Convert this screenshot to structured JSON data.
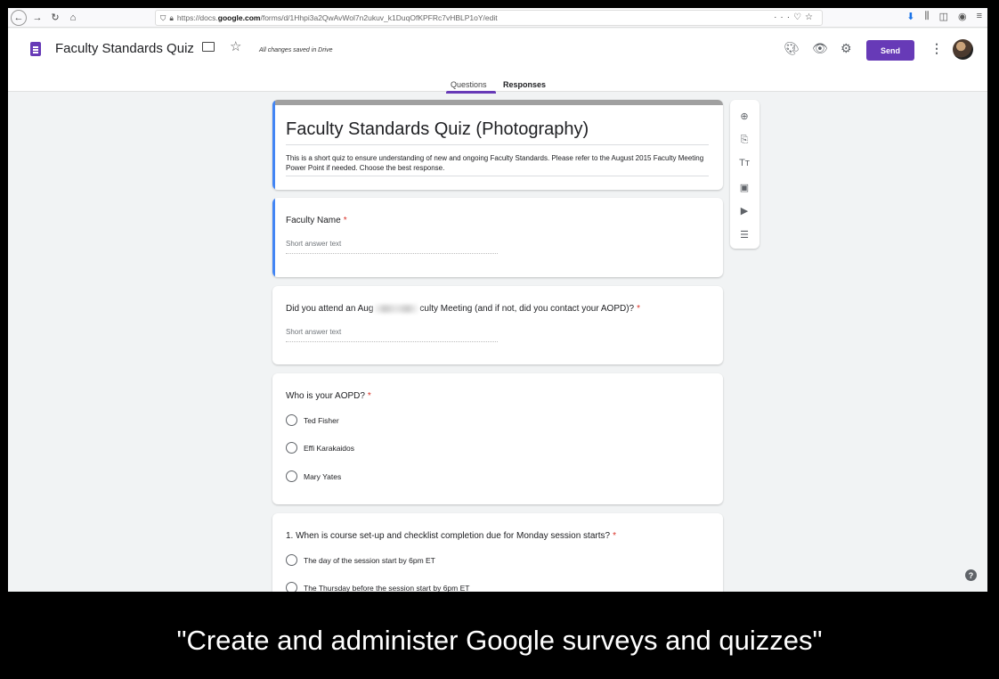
{
  "browser": {
    "url_prefix": "https://docs.",
    "url_domain": "google.com",
    "url_suffix": "/forms/d/1Hhpi3a2QwAvWol7n2ukuv_k1DuqOfKPFRc7vHBLP1oY/edit",
    "icons": [
      "back-arrow-icon",
      "forward-arrow-icon",
      "reload-icon",
      "home-icon",
      "shield-icon",
      "lock-icon",
      "more-icon",
      "pocket-icon",
      "star-icon",
      "download-icon",
      "library-icon",
      "sidebar-icon",
      "account-icon"
    ]
  },
  "header": {
    "doc_title": "Faculty Standards Quiz",
    "save_status": "All changes saved in Drive",
    "send_label": "Send",
    "tabs": [
      {
        "label": "Questions",
        "active": true
      },
      {
        "label": "Responses",
        "active": false
      }
    ],
    "accent": "#673ab7"
  },
  "form": {
    "title": "Faculty Standards Quiz (Photography)",
    "description": "This is a short quiz to ensure understanding of new and ongoing Faculty Standards. Please refer to the August 2015 Faculty Meeting Power Point if needed. Choose the best response.",
    "questions": [
      {
        "title": "Faculty Name",
        "required": "*",
        "placeholder": "Short answer text"
      },
      {
        "title_before": "Did you attend an Aug",
        "title_after": "culty Meeting (and if not, did you contact your AOPD)?",
        "required": "*",
        "placeholder": "Short answer text"
      },
      {
        "title": "Who is your AOPD?",
        "required": "*",
        "options": [
          "Ted Fisher",
          "Effi Karakaidos",
          "Mary Yates"
        ]
      },
      {
        "title": "1. When is course set-up and checklist completion due for Monday session starts?",
        "required": "*",
        "options": [
          "The day of the session start by 6pm ET",
          "The Thursday before the session start by 6pm ET"
        ]
      }
    ]
  },
  "side_toolbar": [
    "add-question-icon",
    "import-questions-icon",
    "add-title-icon",
    "add-image-icon",
    "add-video-icon",
    "add-section-icon"
  ],
  "caption": "\"Create and administer Google surveys and quizzes\""
}
